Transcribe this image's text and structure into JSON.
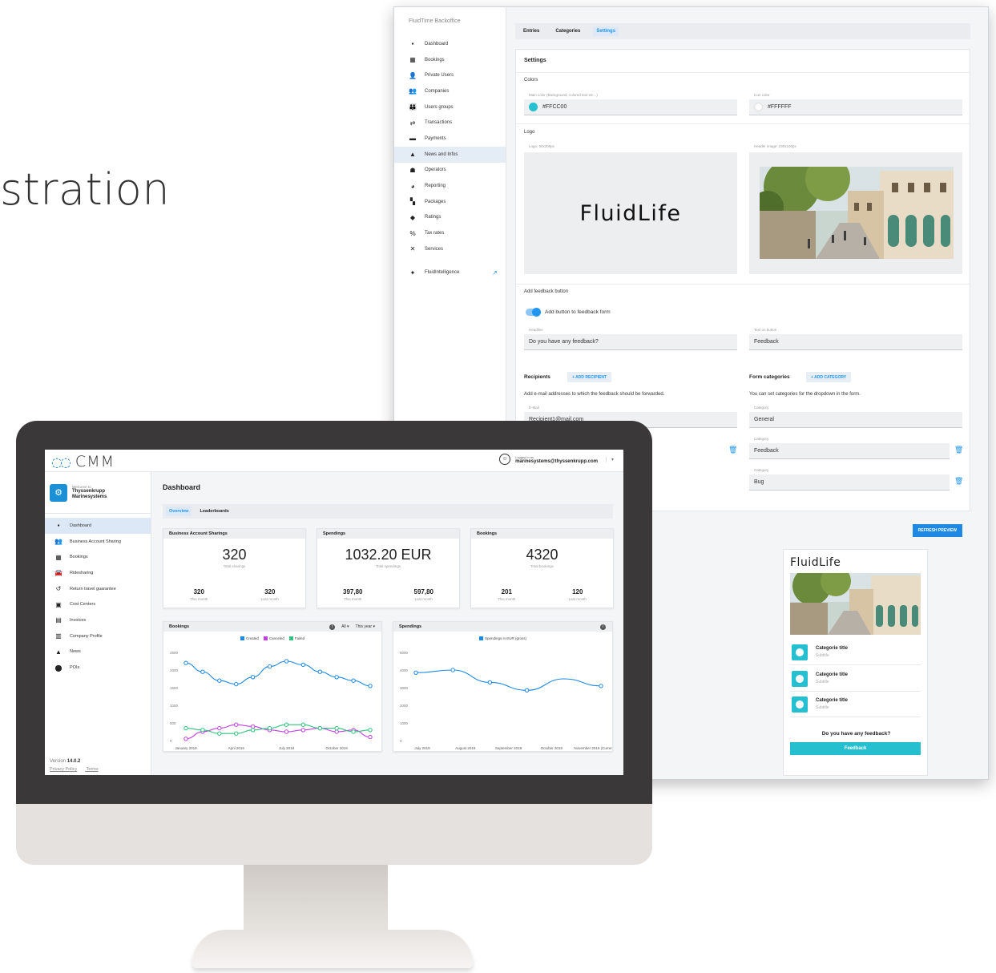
{
  "hero": {
    "text": "stration"
  },
  "admin": {
    "brand": "FluidTime Backoffice",
    "nav": [
      {
        "label": "Dashboard",
        "icon": "dashboard-icon",
        "glyph": "▪"
      },
      {
        "label": "Bookings",
        "icon": "bookings-icon",
        "glyph": "▦"
      },
      {
        "label": "Private Users",
        "icon": "user-icon",
        "glyph": "👤"
      },
      {
        "label": "Companies",
        "icon": "companies-icon",
        "glyph": "👥"
      },
      {
        "label": "Users groups",
        "icon": "users-groups-icon",
        "glyph": "👪"
      },
      {
        "label": "Transactions",
        "icon": "transactions-icon",
        "glyph": "⇄"
      },
      {
        "label": "Payments",
        "icon": "payments-icon",
        "glyph": "▬"
      },
      {
        "label": "News and Infos",
        "icon": "news-icon",
        "glyph": "▲"
      },
      {
        "label": "Operators",
        "icon": "operators-icon",
        "glyph": "☗"
      },
      {
        "label": "Reporting",
        "icon": "reporting-icon",
        "glyph": "◕"
      },
      {
        "label": "Packages",
        "icon": "packages-icon",
        "glyph": "▚"
      },
      {
        "label": "Ratings",
        "icon": "ratings-icon",
        "glyph": "◆"
      },
      {
        "label": "Tax rates",
        "icon": "tax-icon",
        "glyph": "%"
      },
      {
        "label": "Services",
        "icon": "services-icon",
        "glyph": "✕"
      },
      {
        "label": "FluidIntelligence",
        "icon": "intelligence-icon",
        "glyph": "✦"
      }
    ],
    "tabs": [
      "Entries",
      "Categories",
      "Settings"
    ],
    "settings": {
      "title": "Settings",
      "colors_label": "Colors",
      "main_color_label": "Main color (Background, colored text etc...)",
      "main_color": "#FFCC00",
      "main_color_swatch": "#26bfd0",
      "icon_color_label": "Icon color",
      "icon_color": "#FFFFFF",
      "logo_label": "Logo",
      "logo_size_label": "Logo: 50x300px",
      "header_image_label": "Header image: 230x100px",
      "logo_text": "FluidLife",
      "feedback_section": "Add feedback button",
      "feedback_toggle_label": "Add button to feedback form",
      "headline_label": "Headline",
      "headline_value": "Do you have any feedback?",
      "button_text_label": "Text on button",
      "button_text_value": "Feedback",
      "recipients_title": "Recipients",
      "add_recipient": "+ ADD RECIPIENT",
      "recipients_desc": "Add e-mail addresses to which the feedback should be forwarded.",
      "email_label": "E-Mail",
      "recipient1": "Recipient1@mail.com",
      "form_categories_title": "Form categories",
      "add_category": "+ ADD CATEGORY",
      "categories_desc": "You can set categories for the dropdown in the form.",
      "category_label": "Category",
      "categories": [
        "General",
        "Feedback",
        "Bug"
      ]
    },
    "refresh_preview": "REFRESH PREVIEW",
    "preview": {
      "title": "FluidLife",
      "items": [
        {
          "title": "Categorie title",
          "subtitle": "Subtitle"
        },
        {
          "title": "Categorie title",
          "subtitle": "Subtitle"
        },
        {
          "title": "Categorie title",
          "subtitle": "Subtitle"
        }
      ],
      "question": "Do you have any feedback?",
      "button": "Feedback"
    }
  },
  "cmm": {
    "app_name": "CMM",
    "logged_in_label": "Logged in as",
    "user_email": "marinesystems@thyssenkrupp.com",
    "welcome_label": "Welcome to",
    "company_line1": "Thyssenkrupp",
    "company_line2": "Marinesystems",
    "nav": [
      {
        "label": "Dashboard",
        "glyph": "▪",
        "icon": "dashboard-icon"
      },
      {
        "label": "Business Account Sharing",
        "glyph": "👥",
        "icon": "account-sharing-icon"
      },
      {
        "label": "Bookings",
        "glyph": "▦",
        "icon": "bookings-icon"
      },
      {
        "label": "Ridesharing",
        "glyph": "🚘",
        "icon": "car-icon"
      },
      {
        "label": "Return travel guarantee",
        "glyph": "↺",
        "icon": "return-icon"
      },
      {
        "label": "Cost Centers",
        "glyph": "▣",
        "icon": "cost-centers-icon"
      },
      {
        "label": "Invoices",
        "glyph": "▤",
        "icon": "invoices-icon"
      },
      {
        "label": "Company Profile",
        "glyph": "▥",
        "icon": "company-icon"
      },
      {
        "label": "News",
        "glyph": "▲",
        "icon": "news-icon"
      },
      {
        "label": "POIs",
        "glyph": "⬤",
        "icon": "pin-icon"
      }
    ],
    "version_label": "Version",
    "version": "14.0.2",
    "privacy": "Privacy Policy",
    "terms": "Terms",
    "page_title": "Dashboard",
    "tabs": [
      "Overview",
      "Leaderboards"
    ],
    "cards": [
      {
        "title": "Business Account Sharings",
        "big": "320",
        "big_label": "Total sharings",
        "a": "320",
        "a_label": "This month",
        "b": "320",
        "b_label": "Last month"
      },
      {
        "title": "Spendings",
        "big": "1032.20 EUR",
        "big_label": "Total spendings",
        "a": "397,80",
        "a_label": "This month",
        "b": "597,80",
        "b_label": "Last month"
      },
      {
        "title": "Bookings",
        "big": "4320",
        "big_label": "Total bookings",
        "a": "201",
        "a_label": "This month",
        "b": "120",
        "b_label": "Last month"
      }
    ],
    "bookings_chart": {
      "title": "Bookings",
      "filter": "All ▾",
      "period": "This year ▾"
    },
    "spendings_chart": {
      "title": "Spendings"
    }
  },
  "chart_data": [
    {
      "type": "line",
      "title": "Bookings",
      "x": [
        "January 2019",
        "",
        "",
        "April 2019",
        "",
        "",
        "July 2019",
        "",
        "",
        "October 2019",
        "",
        ""
      ],
      "ylim": [
        0,
        2500
      ],
      "yticks": [
        0,
        500,
        1000,
        1500,
        2000,
        2500
      ],
      "grid": false,
      "legend": "top-center",
      "series": [
        {
          "name": "Created",
          "color": "#1e88e5",
          "values": [
            2200,
            1950,
            1700,
            1600,
            1800,
            2100,
            2250,
            2150,
            1950,
            1800,
            1700,
            1550
          ]
        },
        {
          "name": "Canceled",
          "color": "#c040e0",
          "values": [
            50,
            250,
            350,
            450,
            400,
            300,
            250,
            300,
            350,
            250,
            300,
            100
          ]
        },
        {
          "name": "Failed",
          "color": "#2ec27e",
          "values": [
            350,
            300,
            200,
            200,
            300,
            350,
            450,
            450,
            350,
            350,
            250,
            300
          ]
        }
      ]
    },
    {
      "type": "line",
      "title": "Spendings",
      "x": [
        "July 2019",
        "August 2019",
        "September 2019",
        "October 2019",
        "November 2019 (Current)"
      ],
      "ylim": [
        0,
        5000
      ],
      "yticks": [
        0,
        1000,
        2000,
        3000,
        4000,
        5000
      ],
      "grid": false,
      "legend": "top-center",
      "series": [
        {
          "name": "Spendings in EUR (gross)",
          "color": "#1e88e5",
          "values": [
            3850,
            4000,
            3300,
            2850,
            3500,
            3100
          ]
        }
      ]
    }
  ]
}
